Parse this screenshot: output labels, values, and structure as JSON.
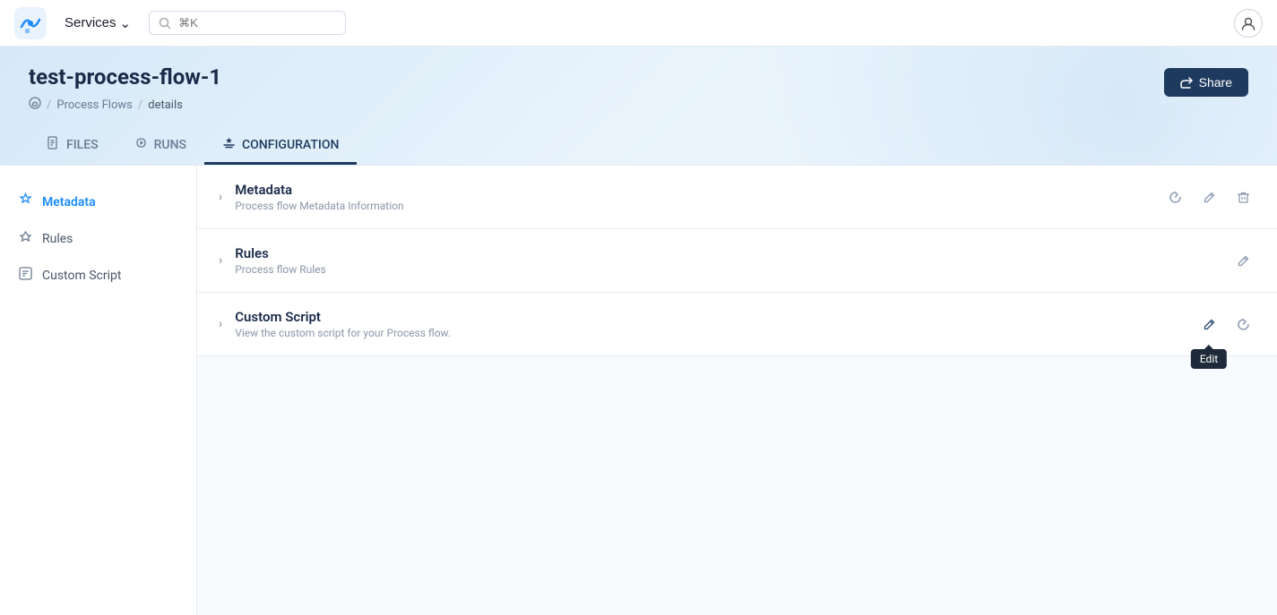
{
  "topnav": {
    "services_label": "Services",
    "search_placeholder": "⌘K",
    "user_icon": "person"
  },
  "page": {
    "title": "test-process-flow-1",
    "breadcrumb": {
      "home": "🌐",
      "process_flows": "Process Flows",
      "current": "details"
    },
    "share_button": "Share"
  },
  "tabs": [
    {
      "id": "files",
      "label": "FILES",
      "icon": "📄"
    },
    {
      "id": "runs",
      "label": "RUNS",
      "icon": "⚡"
    },
    {
      "id": "configuration",
      "label": "CONFIGURATION",
      "icon": "⚙",
      "active": true
    }
  ],
  "sidebar": {
    "items": [
      {
        "id": "metadata",
        "label": "Metadata",
        "icon": "⭐",
        "active": true
      },
      {
        "id": "rules",
        "label": "Rules",
        "icon": "⚡"
      },
      {
        "id": "custom-script",
        "label": "Custom Script",
        "icon": "🖥"
      }
    ]
  },
  "sections": [
    {
      "id": "metadata",
      "title": "Metadata",
      "subtitle": "Process flow Metadata Information",
      "actions": [
        "refresh",
        "edit",
        "delete"
      ]
    },
    {
      "id": "rules",
      "title": "Rules",
      "subtitle": "Process flow Rules",
      "actions": [
        "edit"
      ]
    },
    {
      "id": "custom-script",
      "title": "Custom Script",
      "subtitle": "View the custom script for your Process flow.",
      "actions": [
        "edit",
        "refresh"
      ],
      "tooltip_visible": true,
      "tooltip_text": "Edit"
    }
  ],
  "icons": {
    "chevron_right": "›",
    "refresh": "↻",
    "edit": "✏",
    "delete": "🗑",
    "share": "⤴",
    "person": "👤",
    "chevron_down": "˅"
  }
}
